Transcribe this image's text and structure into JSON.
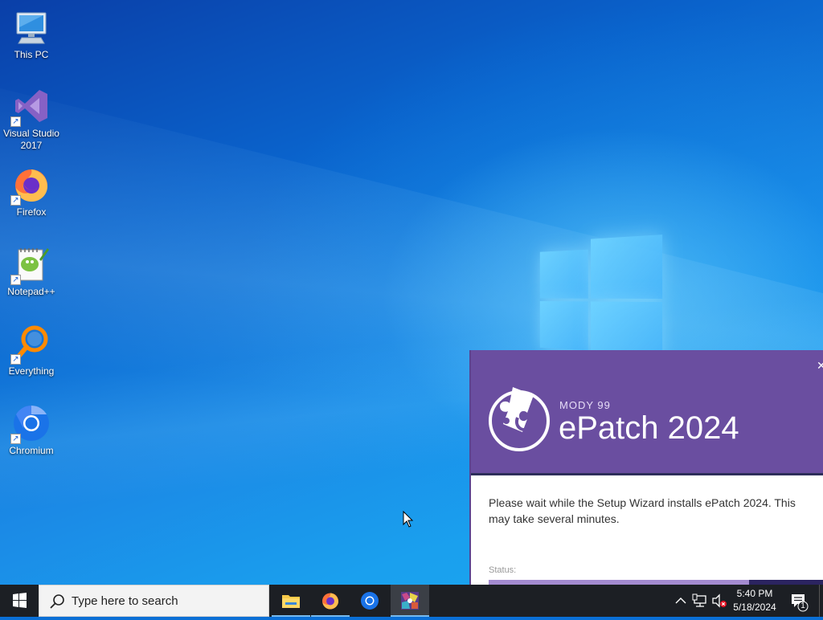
{
  "desktop": {
    "icons": [
      {
        "label": "This PC",
        "icon": "computer-icon",
        "shortcut": false
      },
      {
        "label": "Visual Studio 2017",
        "icon": "visual-studio-icon",
        "shortcut": true
      },
      {
        "label": "Firefox",
        "icon": "firefox-icon",
        "shortcut": true
      },
      {
        "label": "Notepad++",
        "icon": "notepadpp-icon",
        "shortcut": true
      },
      {
        "label": "Everything",
        "icon": "everything-search-icon",
        "shortcut": true
      },
      {
        "label": "Chromium",
        "icon": "chromium-icon",
        "shortcut": true
      }
    ]
  },
  "installer": {
    "brand": "MODY 99",
    "title": "ePatch 2024",
    "close_glyph": "✕",
    "message": "Please wait while the Setup Wizard installs ePatch 2024.  This may take several minutes.",
    "status_label": "Status:",
    "progress_fraction": 0.78,
    "colors": {
      "header": "#6a4ea0",
      "progress_bg": "#2b2460",
      "progress_fill": "#a38bd0"
    }
  },
  "taskbar": {
    "search_placeholder": "Type here to search",
    "apps": [
      {
        "name": "File Explorer",
        "icon": "folder-icon",
        "state": "running"
      },
      {
        "name": "Firefox",
        "icon": "firefox-icon",
        "state": "running"
      },
      {
        "name": "Chromium",
        "icon": "chromium-icon",
        "state": "normal"
      },
      {
        "name": "ePatch 2024",
        "icon": "installer-icon",
        "state": "active"
      }
    ],
    "time": "5:40 PM",
    "date": "5/18/2024",
    "notification_count": "1",
    "colors": {
      "bar": "#1c1f24",
      "accent": "#76b9ed"
    }
  }
}
